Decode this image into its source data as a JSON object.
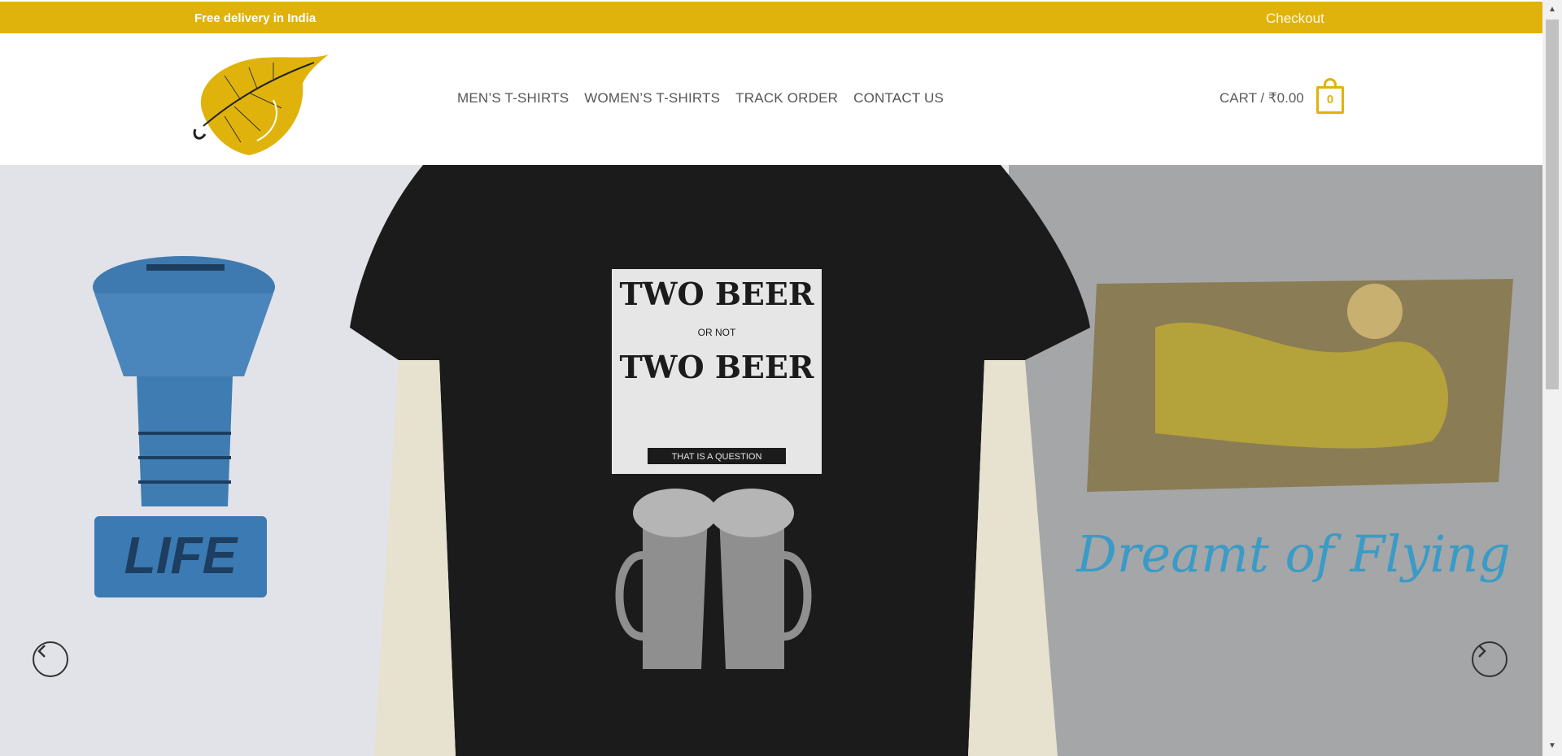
{
  "topbar": {
    "promo": "Free delivery in India",
    "checkout": "Checkout"
  },
  "nav": {
    "mens": "MEN’S T-SHIRTS",
    "womens": "WOMEN’S T-SHIRTS",
    "track": "TRACK ORDER",
    "contact": "CONTACT US"
  },
  "cart": {
    "label": "CART / ₹0.00",
    "count": "0"
  },
  "slides": {
    "left": {
      "print": "LIFE"
    },
    "center": {
      "line1": "TWO BEER",
      "line2": "OR NOT",
      "line3": "TWO BEER",
      "line4": "THAT IS A QUESTION"
    },
    "right": {
      "print": "Dreamt of Flying"
    }
  },
  "colors": {
    "accent": "#e0b30c",
    "nav_text": "#555555"
  },
  "icons": {
    "prev": "chevron-left-icon",
    "next": "chevron-right-icon",
    "logo": "leaf-logo"
  }
}
